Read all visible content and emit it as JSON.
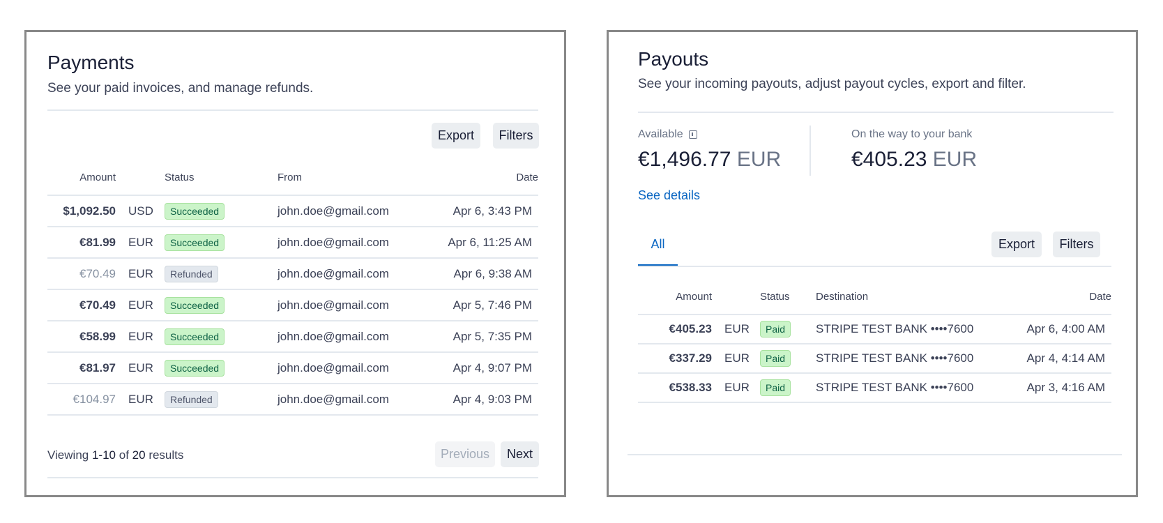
{
  "payments": {
    "title": "Payments",
    "subtitle": "See your paid invoices, and manage refunds.",
    "export_label": "Export",
    "filters_label": "Filters",
    "columns": {
      "amount": "Amount",
      "status": "Status",
      "from": "From",
      "date": "Date"
    },
    "rows": [
      {
        "amount": "$1,092.50",
        "currency": "USD",
        "status": "Succeeded",
        "from": "john.doe@gmail.com",
        "date": "Apr 6, 3:43 PM"
      },
      {
        "amount": "€81.99",
        "currency": "EUR",
        "status": "Succeeded",
        "from": "john.doe@gmail.com",
        "date": "Apr 6, 11:25 AM"
      },
      {
        "amount": "€70.49",
        "currency": "EUR",
        "status": "Refunded",
        "from": "john.doe@gmail.com",
        "date": "Apr 6, 9:38 AM"
      },
      {
        "amount": "€70.49",
        "currency": "EUR",
        "status": "Succeeded",
        "from": "john.doe@gmail.com",
        "date": "Apr 5, 7:46 PM"
      },
      {
        "amount": "€58.99",
        "currency": "EUR",
        "status": "Succeeded",
        "from": "john.doe@gmail.com",
        "date": "Apr 5, 7:35 PM"
      },
      {
        "amount": "€81.97",
        "currency": "EUR",
        "status": "Succeeded",
        "from": "john.doe@gmail.com",
        "date": "Apr 4, 9:07 PM"
      },
      {
        "amount": "€104.97",
        "currency": "EUR",
        "status": "Refunded",
        "from": "john.doe@gmail.com",
        "date": "Apr 4, 9:03 PM"
      }
    ],
    "pager": {
      "viewing": "Viewing",
      "range": "1-10",
      "of": "of",
      "total": "20",
      "results": "results",
      "previous_label": "Previous",
      "next_label": "Next"
    }
  },
  "payouts": {
    "title": "Payouts",
    "subtitle": "See your incoming payouts, adjust payout cycles, export and filter.",
    "available_label": "Available",
    "available_amount": "€1,496.77",
    "available_currency": "EUR",
    "on_way_label": "On the way to your bank",
    "on_way_amount": "€405.23",
    "on_way_currency": "EUR",
    "see_details_label": "See details",
    "tab_all_label": "All",
    "export_label": "Export",
    "filters_label": "Filters",
    "columns": {
      "amount": "Amount",
      "status": "Status",
      "destination": "Destination",
      "date": "Date"
    },
    "rows": [
      {
        "amount": "€405.23",
        "currency": "EUR",
        "status": "Paid",
        "destination": "STRIPE TEST BANK ••••7600",
        "date": "Apr 6, 4:00 AM"
      },
      {
        "amount": "€337.29",
        "currency": "EUR",
        "status": "Paid",
        "destination": "STRIPE TEST BANK ••••7600",
        "date": "Apr 4, 4:14 AM"
      },
      {
        "amount": "€538.33",
        "currency": "EUR",
        "status": "Paid",
        "destination": "STRIPE TEST BANK ••••7600",
        "date": "Apr 3, 4:16 AM"
      }
    ]
  },
  "colors": {
    "accent": "#0a66c2",
    "success_bg": "#cbf4c9",
    "success_text": "#0e6245",
    "refunded_bg": "#e3e8ee",
    "panel_border": "#888888"
  },
  "icons": {
    "available_info": "info-icon"
  }
}
